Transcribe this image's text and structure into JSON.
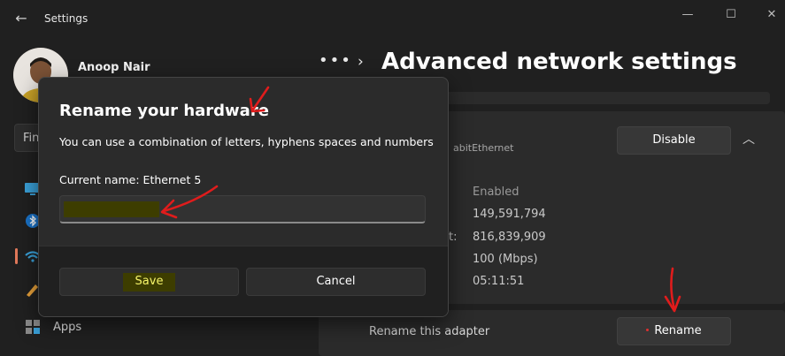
{
  "window": {
    "title": "Settings",
    "back_glyph": "←",
    "minimize_glyph": "—",
    "maximize_glyph": "☐",
    "close_glyph": "✕"
  },
  "user": {
    "name": "Anoop Nair"
  },
  "sidebar": {
    "search_placeholder_partial": "Fin",
    "items": [
      {
        "icon": "display-icon"
      },
      {
        "icon": "bluetooth-icon"
      },
      {
        "icon": "network-icon",
        "selected": true
      },
      {
        "icon": "personalization-icon"
      },
      {
        "icon": "apps-icon",
        "label": "Apps"
      }
    ]
  },
  "header": {
    "ellipsis": "•••",
    "separator": "›",
    "title": "Advanced network settings"
  },
  "adapter": {
    "description_partial": "abitEthernet",
    "disable_label": "Disable",
    "collapse_glyph": "︿",
    "properties": [
      {
        "value": "Enabled"
      },
      {
        "value": "149,591,794"
      },
      {
        "label_fragment": "t:",
        "value": "816,839,909"
      },
      {
        "value": "100 (Mbps)"
      },
      {
        "value": "05:11:51"
      }
    ]
  },
  "rename_section": {
    "label": "Rename this adapter",
    "button_label": "Rename"
  },
  "dialog": {
    "title": "Rename your hardware",
    "description": "You can use a combination of letters, hyphens spaces and numbers",
    "current_name_label": "Current name: Ethernet 5",
    "input_value": "",
    "save_label": "Save",
    "cancel_label": "Cancel"
  },
  "colors": {
    "background": "#202020",
    "card": "#2b2b2b",
    "annotation_red": "#e01c1c",
    "highlight": "#3d3d00",
    "accent_selected": "#e0785a"
  }
}
